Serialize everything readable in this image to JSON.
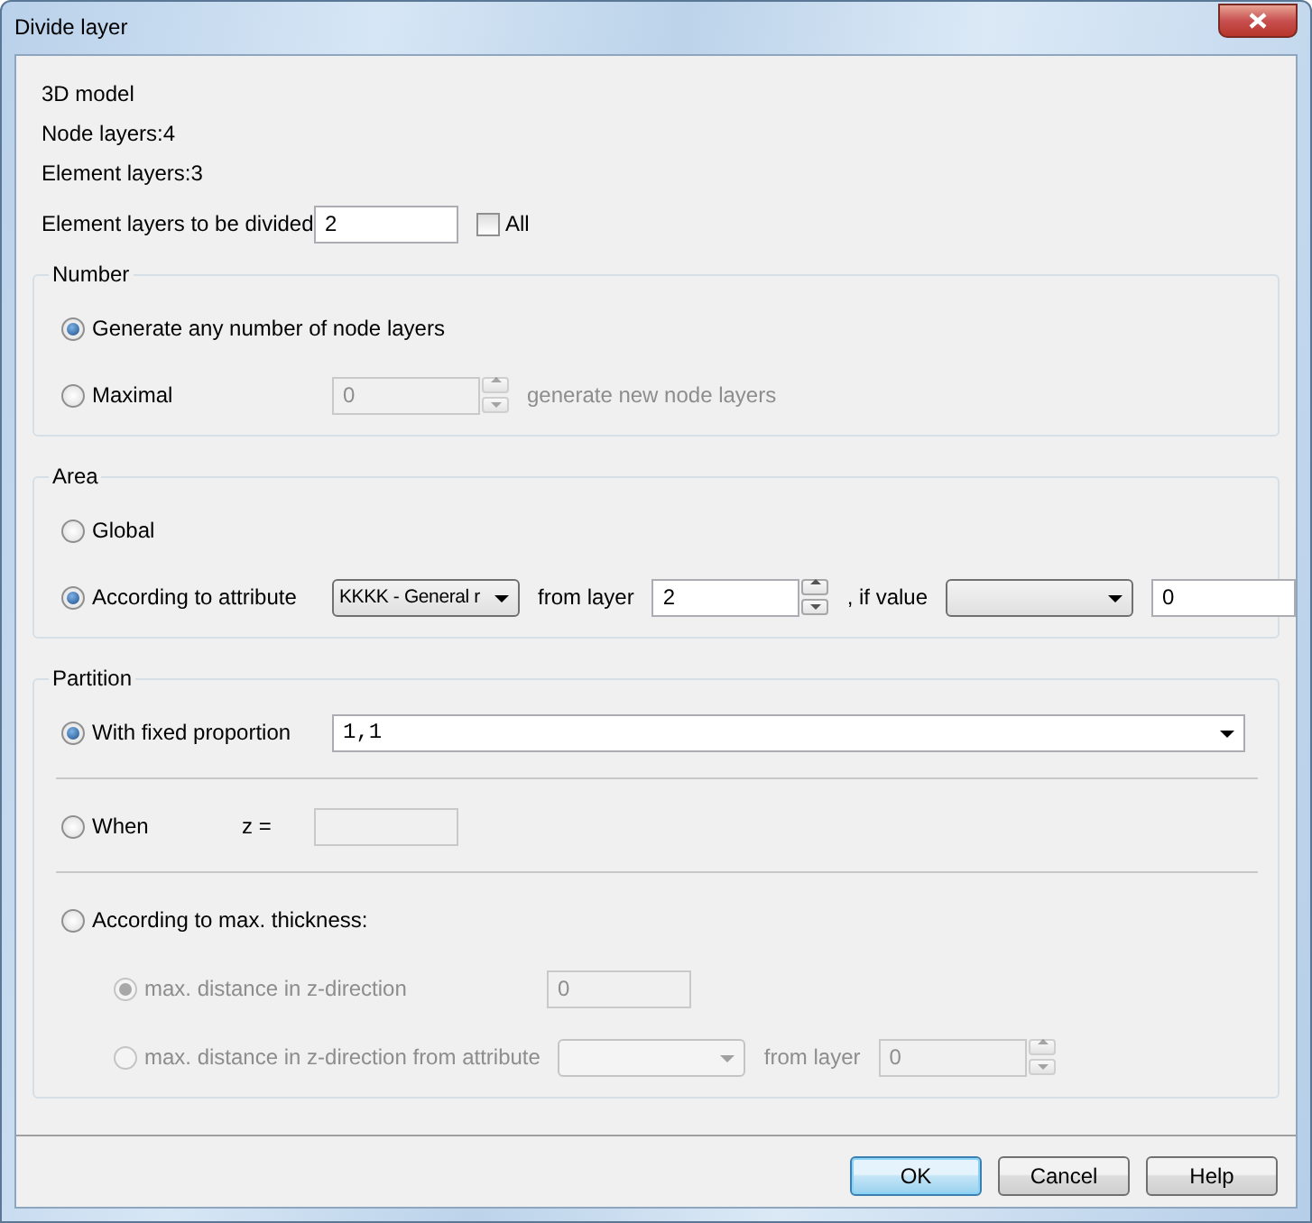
{
  "window": {
    "title": "Divide layer"
  },
  "info": [
    "3D model",
    "Node layers:4",
    "Element layers:3"
  ],
  "layers_to_divide": {
    "label": "Element layers to be divided",
    "value": "2",
    "all": {
      "label": "All",
      "checked": false
    }
  },
  "groups": [
    {
      "title": "Number",
      "rows": [
        {
          "kind": "row",
          "items": [
            {
              "kind": "radio",
              "label": "Generate any number of node layers",
              "selected": true,
              "disabled": false
            }
          ]
        },
        {
          "kind": "row",
          "items": [
            {
              "kind": "radio",
              "label": "Maximal",
              "selected": false,
              "disabled": false
            },
            {
              "kind": "spin",
              "value": "0",
              "disabled": true
            },
            {
              "kind": "text",
              "label": "generate new node layers",
              "disabled": true
            }
          ]
        }
      ]
    },
    {
      "title": "Area",
      "rows": [
        {
          "kind": "row",
          "items": [
            {
              "kind": "radio",
              "label": "Global",
              "selected": false,
              "disabled": false
            }
          ]
        },
        {
          "kind": "row",
          "items": [
            {
              "kind": "radio",
              "label": "According to attribute",
              "selected": true,
              "disabled": false
            },
            {
              "kind": "select",
              "value": "KKKK - General r",
              "disabled": false
            },
            {
              "kind": "text",
              "label": "from layer",
              "disabled": false
            },
            {
              "kind": "spin",
              "value": "2",
              "disabled": false
            },
            {
              "kind": "text",
              "label": ", if value",
              "disabled": false
            },
            {
              "kind": "select",
              "disabled": false
            },
            {
              "kind": "input",
              "value": "0",
              "disabled": false
            }
          ]
        }
      ]
    },
    {
      "title": "Partition",
      "rows": [
        {
          "kind": "row",
          "items": [
            {
              "kind": "radio",
              "label": "With fixed proportion",
              "selected": true,
              "disabled": false
            },
            {
              "kind": "combo",
              "value": "1,1",
              "disabled": false
            }
          ]
        },
        {
          "kind": "separator"
        },
        {
          "kind": "row",
          "items": [
            {
              "kind": "radio",
              "label": "When",
              "selected": false,
              "disabled": false
            },
            {
              "kind": "prefix",
              "label": "z =",
              "disabled": false
            },
            {
              "kind": "input",
              "disabled": true
            }
          ]
        },
        {
          "kind": "separator"
        },
        {
          "kind": "row",
          "items": [
            {
              "kind": "radio",
              "label": "According to max. thickness:",
              "selected": false,
              "disabled": false
            }
          ],
          "children": [
            {
              "kind": "row",
              "items": [
                {
                  "kind": "radio",
                  "label": "max. distance in z-direction",
                  "selected": true,
                  "disabled": true
                },
                {
                  "kind": "input",
                  "value": "0",
                  "disabled": true
                }
              ]
            },
            {
              "kind": "row",
              "items": [
                {
                  "kind": "radio",
                  "label": "max. distance in z-direction from attribute",
                  "selected": false,
                  "disabled": true
                },
                {
                  "kind": "select",
                  "disabled": true
                },
                {
                  "kind": "text",
                  "label": "from layer",
                  "disabled": true
                },
                {
                  "kind": "spin",
                  "value": "0",
                  "disabled": true
                }
              ]
            }
          ]
        }
      ]
    }
  ],
  "buttons": [
    {
      "label": "OK",
      "default": true
    },
    {
      "label": "Cancel",
      "default": false
    },
    {
      "label": "Help",
      "default": false
    }
  ]
}
